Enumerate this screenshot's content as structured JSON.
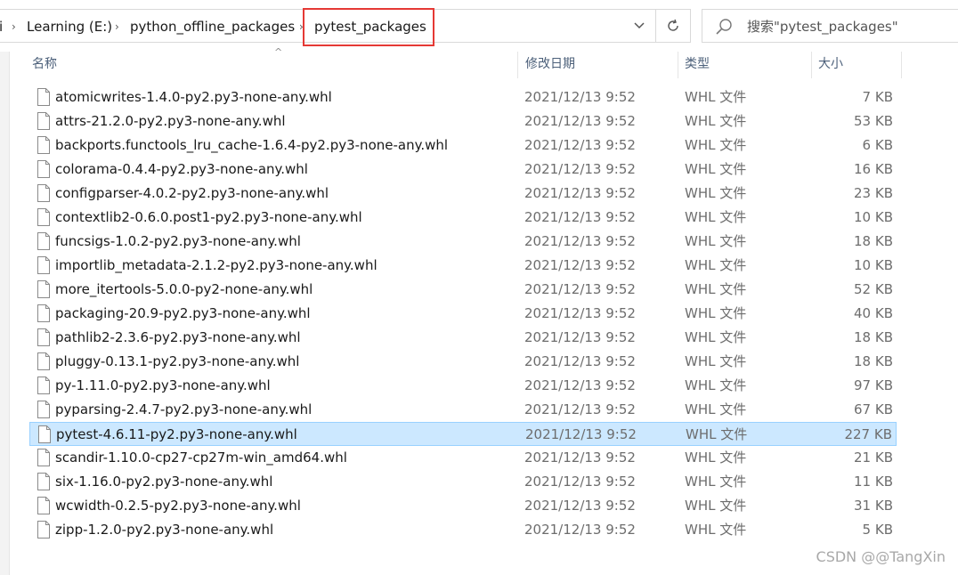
{
  "breadcrumb": {
    "items": [
      "Learning (E:)",
      "python_offline_packages",
      "pytest_packages"
    ],
    "separator": "›",
    "lead_fragment": "i"
  },
  "search": {
    "placeholder": "搜索\"pytest_packages\""
  },
  "columns": {
    "name": "名称",
    "date": "修改日期",
    "type": "类型",
    "size": "大小"
  },
  "files": [
    {
      "name": "atomicwrites-1.4.0-py2.py3-none-any.whl",
      "date": "2021/12/13 9:52",
      "type": "WHL 文件",
      "size": "7 KB"
    },
    {
      "name": "attrs-21.2.0-py2.py3-none-any.whl",
      "date": "2021/12/13 9:52",
      "type": "WHL 文件",
      "size": "53 KB"
    },
    {
      "name": "backports.functools_lru_cache-1.6.4-py2.py3-none-any.whl",
      "date": "2021/12/13 9:52",
      "type": "WHL 文件",
      "size": "6 KB"
    },
    {
      "name": "colorama-0.4.4-py2.py3-none-any.whl",
      "date": "2021/12/13 9:52",
      "type": "WHL 文件",
      "size": "16 KB"
    },
    {
      "name": "configparser-4.0.2-py2.py3-none-any.whl",
      "date": "2021/12/13 9:52",
      "type": "WHL 文件",
      "size": "23 KB"
    },
    {
      "name": "contextlib2-0.6.0.post1-py2.py3-none-any.whl",
      "date": "2021/12/13 9:52",
      "type": "WHL 文件",
      "size": "10 KB"
    },
    {
      "name": "funcsigs-1.0.2-py2.py3-none-any.whl",
      "date": "2021/12/13 9:52",
      "type": "WHL 文件",
      "size": "18 KB"
    },
    {
      "name": "importlib_metadata-2.1.2-py2.py3-none-any.whl",
      "date": "2021/12/13 9:52",
      "type": "WHL 文件",
      "size": "10 KB"
    },
    {
      "name": "more_itertools-5.0.0-py2-none-any.whl",
      "date": "2021/12/13 9:52",
      "type": "WHL 文件",
      "size": "52 KB"
    },
    {
      "name": "packaging-20.9-py2.py3-none-any.whl",
      "date": "2021/12/13 9:52",
      "type": "WHL 文件",
      "size": "40 KB"
    },
    {
      "name": "pathlib2-2.3.6-py2.py3-none-any.whl",
      "date": "2021/12/13 9:52",
      "type": "WHL 文件",
      "size": "18 KB"
    },
    {
      "name": "pluggy-0.13.1-py2.py3-none-any.whl",
      "date": "2021/12/13 9:52",
      "type": "WHL 文件",
      "size": "18 KB"
    },
    {
      "name": "py-1.11.0-py2.py3-none-any.whl",
      "date": "2021/12/13 9:52",
      "type": "WHL 文件",
      "size": "97 KB"
    },
    {
      "name": "pyparsing-2.4.7-py2.py3-none-any.whl",
      "date": "2021/12/13 9:52",
      "type": "WHL 文件",
      "size": "67 KB"
    },
    {
      "name": "pytest-4.6.11-py2.py3-none-any.whl",
      "date": "2021/12/13 9:52",
      "type": "WHL 文件",
      "size": "227 KB",
      "selected": true
    },
    {
      "name": "scandir-1.10.0-cp27-cp27m-win_amd64.whl",
      "date": "2021/12/13 9:52",
      "type": "WHL 文件",
      "size": "21 KB"
    },
    {
      "name": "six-1.16.0-py2.py3-none-any.whl",
      "date": "2021/12/13 9:52",
      "type": "WHL 文件",
      "size": "11 KB"
    },
    {
      "name": "wcwidth-0.2.5-py2.py3-none-any.whl",
      "date": "2021/12/13 9:52",
      "type": "WHL 文件",
      "size": "31 KB"
    },
    {
      "name": "zipp-1.2.0-py2.py3-none-any.whl",
      "date": "2021/12/13 9:52",
      "type": "WHL 文件",
      "size": "5 KB"
    }
  ],
  "watermark": "CSDN @@TangXin",
  "colors": {
    "selection_bg": "#cce8ff",
    "selection_border": "#99d1ff",
    "highlight_box": "#e53935",
    "header_text": "#4c607a"
  },
  "icons": {
    "search": "search-icon",
    "refresh": "refresh-icon",
    "dropdown": "chevron-down-icon",
    "file": "file-icon"
  }
}
